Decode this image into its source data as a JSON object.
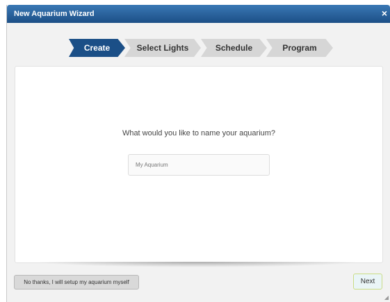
{
  "dialog": {
    "title": "New Aquarium Wizard",
    "close_icon": "close-icon",
    "close_glyph": "×"
  },
  "steps": [
    {
      "label": "Create",
      "active": true
    },
    {
      "label": "Select Lights",
      "active": false
    },
    {
      "label": "Schedule",
      "active": false
    },
    {
      "label": "Program",
      "active": false
    }
  ],
  "form": {
    "question": "What would you like to name your aquarium?",
    "name_value": "My Aquarium"
  },
  "footer": {
    "skip_label": "No thanks, I will setup my aquarium myself",
    "next_label": "Next"
  },
  "colors": {
    "titlebar": "#1c4f86",
    "active_step": "#1b4f87",
    "inactive_step": "#d6d6d6"
  }
}
